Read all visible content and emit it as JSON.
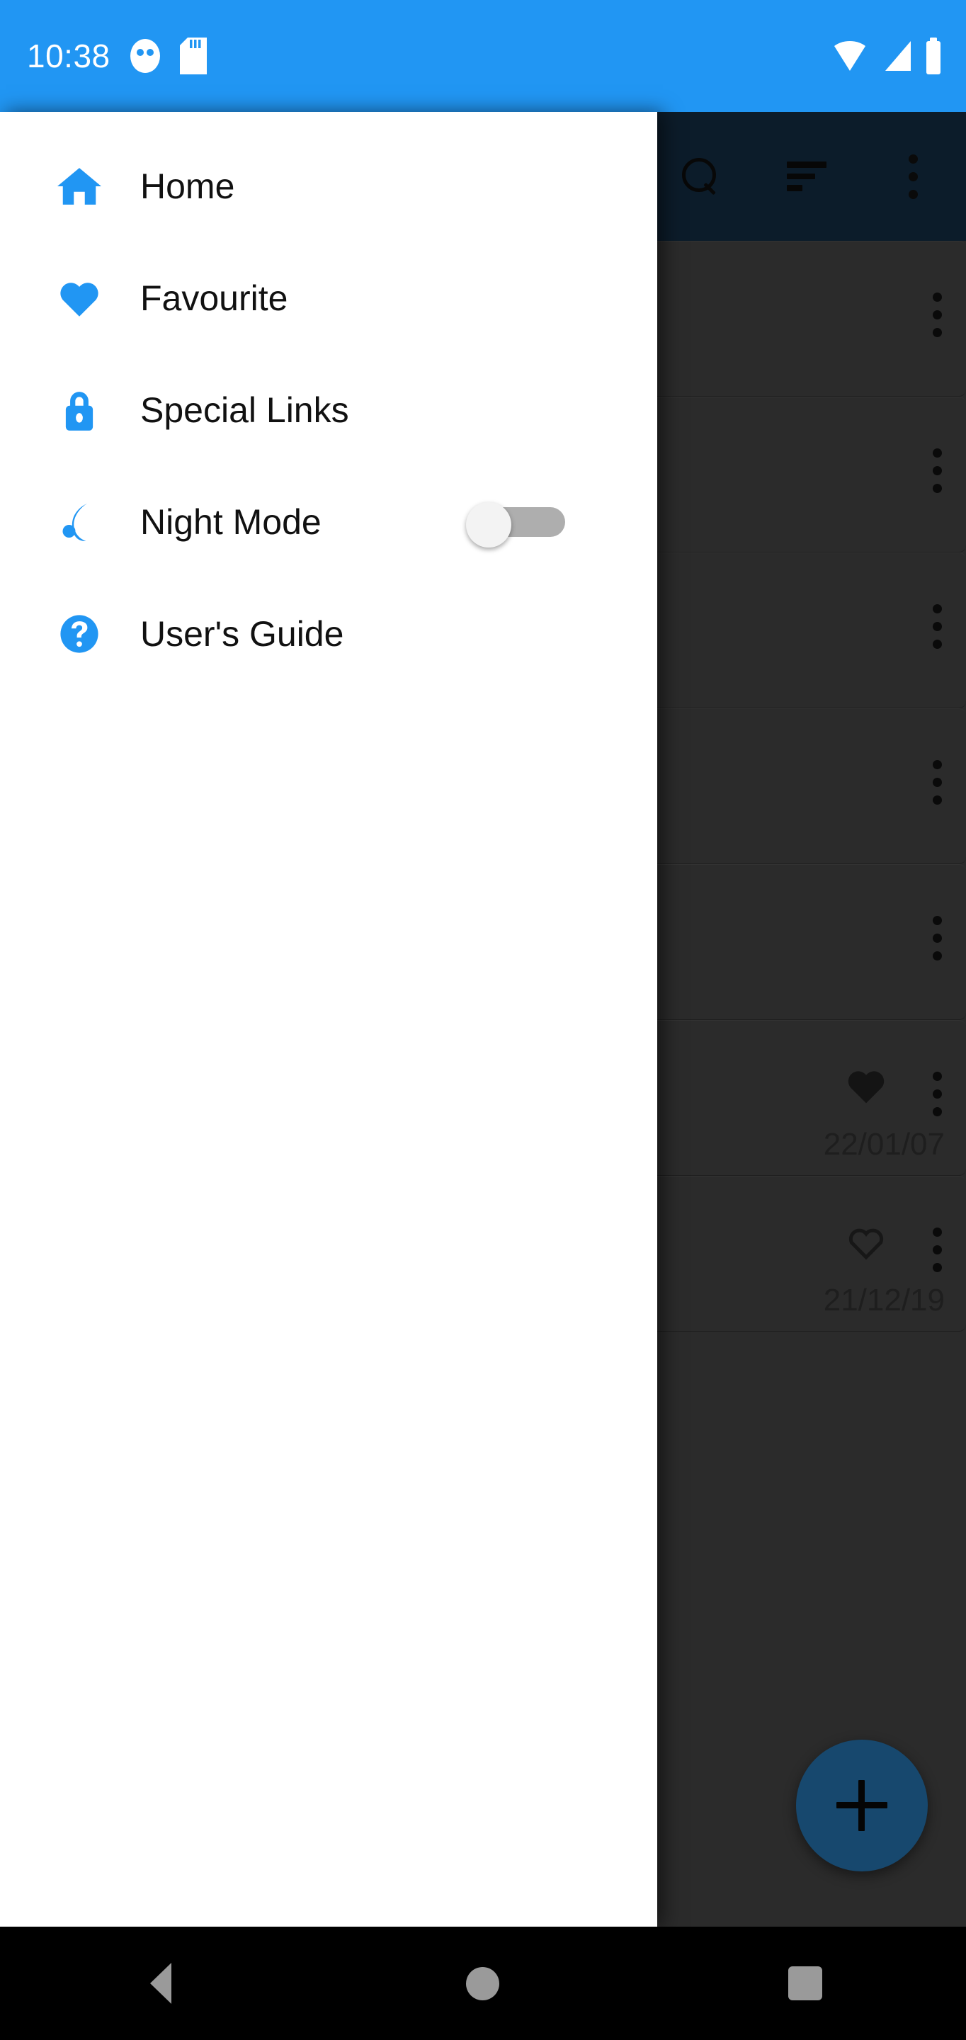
{
  "status_bar": {
    "time": "10:38",
    "background": "#2196f3",
    "left_icons": [
      "notification-circle-icon",
      "sd-card-icon"
    ],
    "right_icons": [
      "wifi-icon",
      "cellular-signal-icon",
      "battery-icon"
    ]
  },
  "app_bar": {
    "background": "#0c1c2a",
    "actions": [
      {
        "name": "search-icon",
        "label": "Search"
      },
      {
        "name": "sort-icon",
        "label": "Sort"
      },
      {
        "name": "overflow-menu-icon",
        "label": "More options"
      }
    ]
  },
  "drawer": {
    "background": "#ffffff",
    "accent": "#2196f3",
    "items": [
      {
        "label": "Home",
        "icon": "home-icon"
      },
      {
        "label": "Favourite",
        "icon": "heart-icon"
      },
      {
        "label": "Special Links",
        "icon": "lock-icon"
      },
      {
        "label": "Night Mode",
        "icon": "moon-icon",
        "toggle": true,
        "toggle_state": "off"
      },
      {
        "label": "User's Guide",
        "icon": "question-circle-icon"
      }
    ]
  },
  "content": {
    "cards": [
      {
        "date": "",
        "favourite": null
      },
      {
        "date": "",
        "favourite": null
      },
      {
        "date": "",
        "favourite": null
      },
      {
        "date": "",
        "favourite": null
      },
      {
        "date": "",
        "favourite": null
      },
      {
        "date": "22/01/07",
        "favourite": "filled"
      },
      {
        "date": "21/12/19",
        "favourite": "outline"
      }
    ],
    "fab": {
      "label": "+",
      "name": "add-button",
      "color": "#17486e"
    }
  },
  "nav_bar": {
    "buttons": [
      {
        "name": "nav-back-button",
        "label": "Back"
      },
      {
        "name": "nav-home-button",
        "label": "Home"
      },
      {
        "name": "nav-recents-button",
        "label": "Recents"
      }
    ]
  }
}
